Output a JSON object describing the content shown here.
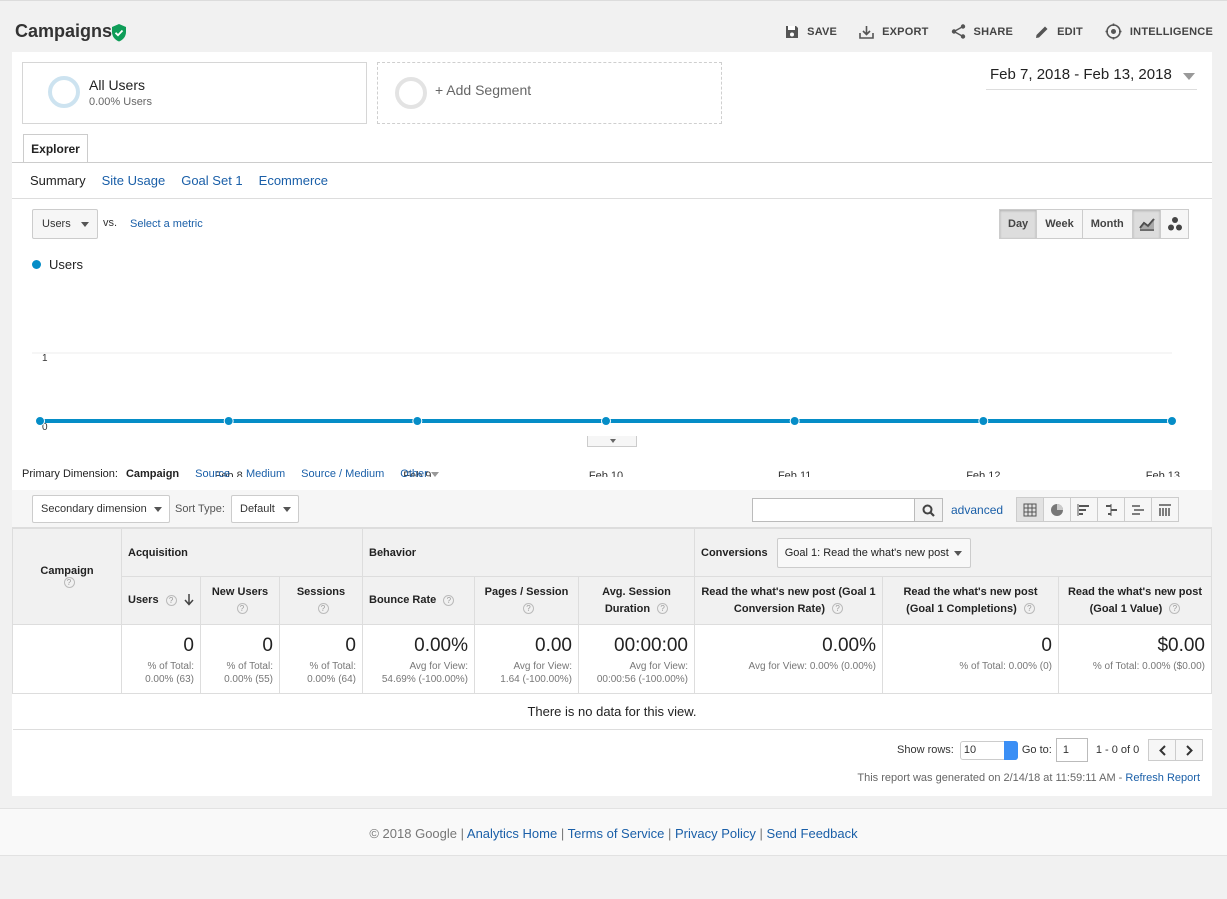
{
  "header": {
    "title": "Campaigns",
    "actions": [
      {
        "label": "SAVE",
        "icon": "save-icon"
      },
      {
        "label": "EXPORT",
        "icon": "export-icon"
      },
      {
        "label": "SHARE",
        "icon": "share-icon"
      },
      {
        "label": "EDIT",
        "icon": "edit-icon"
      },
      {
        "label": "INTELLIGENCE",
        "icon": "intelligence-icon"
      }
    ]
  },
  "segments": {
    "active": {
      "name": "All Users",
      "sub": "0.00% Users"
    },
    "add_label": "+ Add Segment"
  },
  "date_range": "Feb 7, 2018 - Feb 13, 2018",
  "tabs": {
    "explorer": "Explorer",
    "subtabs": [
      "Summary",
      "Site Usage",
      "Goal Set 1",
      "Ecommerce"
    ]
  },
  "chart_controls": {
    "metric": "Users",
    "vs": "vs.",
    "select_metric": "Select a metric",
    "periods": [
      "Day",
      "Week",
      "Month"
    ],
    "active_period": "Day"
  },
  "chart_data": {
    "type": "line",
    "x": [
      "...",
      "Feb 8",
      "Feb 9",
      "Feb 10",
      "Feb 11",
      "Feb 12",
      "Feb 13"
    ],
    "series": [
      {
        "name": "Users",
        "values": [
          0,
          0,
          0,
          0,
          0,
          0,
          0
        ],
        "color": "#058dc7"
      }
    ],
    "yticks": [
      "1",
      "0"
    ],
    "ylim": [
      0,
      1
    ]
  },
  "primary_dimension": {
    "label": "Primary Dimension:",
    "active": "Campaign",
    "options": [
      "Source",
      "Medium",
      "Source / Medium",
      "Other"
    ]
  },
  "toolbar": {
    "secondary_dimension": "Secondary dimension",
    "sort_type_label": "Sort Type:",
    "sort_type": "Default",
    "advanced": "advanced"
  },
  "table": {
    "campaign_header": "Campaign",
    "groups": {
      "acquisition": "Acquisition",
      "behavior": "Behavior",
      "conversions": "Conversions"
    },
    "goal_select": "Goal 1: Read the what's new post",
    "columns": [
      {
        "label": "Users",
        "total": "0",
        "sub1": "% of Total:",
        "sub2": "0.00% (63)"
      },
      {
        "label": "New Users",
        "total": "0",
        "sub1": "% of Total:",
        "sub2": "0.00% (55)"
      },
      {
        "label": "Sessions",
        "total": "0",
        "sub1": "% of Total:",
        "sub2": "0.00% (64)"
      },
      {
        "label": "Bounce Rate",
        "total": "0.00%",
        "sub1": "Avg for View:",
        "sub2": "54.69% (-100.00%)"
      },
      {
        "label": "Pages / Session",
        "total": "0.00",
        "sub1": "Avg for View:",
        "sub2": "1.64 (-100.00%)"
      },
      {
        "label": "Avg. Session Duration",
        "total": "00:00:00",
        "sub1": "Avg for View:",
        "sub2": "00:00:56 (-100.00%)"
      },
      {
        "label": "Read the what's new post (Goal 1 Conversion Rate)",
        "total": "0.00%",
        "sub1": "Avg for View: 0.00% (0.00%)",
        "sub2": ""
      },
      {
        "label": "Read the what's new post (Goal 1 Completions)",
        "total": "0",
        "sub1": "% of Total: 0.00% (0)",
        "sub2": ""
      },
      {
        "label": "Read the what's new post (Goal 1 Value)",
        "total": "$0.00",
        "sub1": "% of Total: 0.00% ($0.00)",
        "sub2": ""
      }
    ],
    "no_data": "There is no data for this view."
  },
  "pager": {
    "show_rows_label": "Show rows:",
    "rows": "10",
    "goto_label": "Go to:",
    "goto_value": "1",
    "range": "1 - 0 of 0"
  },
  "generated": {
    "text": "This report was generated on 2/14/18 at 11:59:11 AM - ",
    "link": "Refresh Report"
  },
  "footer": {
    "copyright": "© 2018 Google |",
    "links": [
      "Analytics Home",
      "Terms of Service",
      "Privacy Policy",
      "Send Feedback"
    ]
  }
}
